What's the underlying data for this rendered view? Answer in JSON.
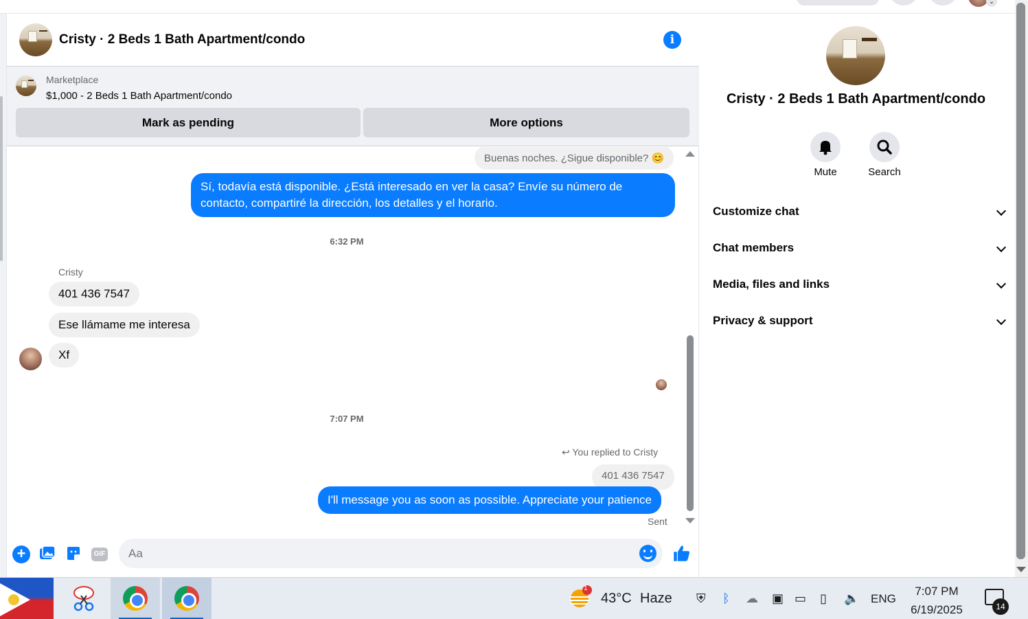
{
  "chat": {
    "title": "Cristy · 2 Beds 1 Bath Apartment/condo",
    "marketplace_label": "Marketplace",
    "listing": "$1,000 - 2 Beds 1 Bath Apartment/condo",
    "mark_pending": "Mark as pending",
    "more_options": "More options"
  },
  "messages": {
    "m1": "Buenas noches. ¿Sigue disponible? 😊",
    "m2": "Sí, todavía está disponible. ¿Está interesado en ver la casa? Envíe su número de contacto, compartiré la dirección, los detalles y el horario.",
    "time1": "6:32 PM",
    "sender": "Cristy",
    "in1": "401 436 7547",
    "in2": "Ese llámame me interesa",
    "in3": "Xf",
    "time2": "7:07 PM",
    "reply_note": "You replied to Cristy",
    "quoted": "401 436 7547",
    "out2": "I'll message you as soon as possible. Appreciate your patience",
    "status": "Sent"
  },
  "composer": {
    "placeholder": "Aa",
    "gif_label": "GIF"
  },
  "right_panel": {
    "title": "Cristy · 2 Beds 1 Bath Apartment/condo",
    "mute": "Mute",
    "search": "Search",
    "rows": [
      "Customize chat",
      "Chat members",
      "Media, files and links",
      "Privacy & support"
    ]
  },
  "taskbar": {
    "weather_badge": "1",
    "temperature": "43°C",
    "weather": "Haze",
    "language": "ENG",
    "time": "7:07 PM",
    "date": "6/19/2025",
    "notifications": "14"
  }
}
